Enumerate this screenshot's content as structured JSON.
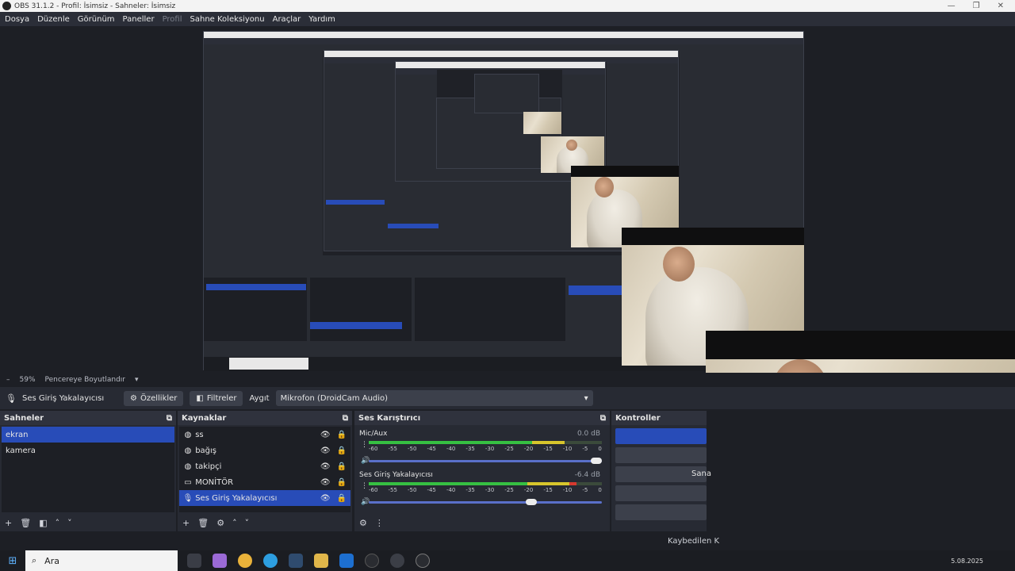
{
  "window": {
    "title": "OBS 31.1.2 - Profil: İsimsiz - Sahneler: İsimsiz"
  },
  "menu": {
    "items": [
      "Dosya",
      "Düzenle",
      "Görünüm",
      "Paneller",
      "Profil",
      "Sahne Koleksiyonu",
      "Araçlar",
      "Yardım"
    ]
  },
  "zoom": {
    "value": "59%",
    "mode": "Pencereye Boyutlandır"
  },
  "properties_bar": {
    "source_name": "Ses Giriş Yakalayıcısı",
    "properties_label": "Özellikler",
    "filters_label": "Filtreler",
    "device_label": "Aygıt",
    "device_value": "Mikrofon (DroidCam Audio)"
  },
  "scenes": {
    "title": "Sahneler",
    "items": [
      {
        "label": "ekran",
        "selected": true
      },
      {
        "label": "kamera",
        "selected": false
      }
    ]
  },
  "sources": {
    "title": "Kaynaklar",
    "items": [
      {
        "label": "ss",
        "icon": "globe-icon",
        "selected": false
      },
      {
        "label": "bağış",
        "icon": "globe-icon",
        "selected": false
      },
      {
        "label": "takipçi",
        "icon": "globe-icon",
        "selected": false
      },
      {
        "label": "MONİTÖR",
        "icon": "monitor-icon",
        "selected": false
      },
      {
        "label": "Ses Giriş Yakalayıcısı",
        "icon": "microphone-icon",
        "selected": true
      }
    ]
  },
  "mixer": {
    "title": "Ses Karıştırıcı",
    "ticks": [
      "-60",
      "-55",
      "-50",
      "-45",
      "-40",
      "-35",
      "-30",
      "-25",
      "-20",
      "-15",
      "-10",
      "-5",
      "0"
    ],
    "channels": [
      {
        "name": "Mic/Aux",
        "db": "0.0 dB",
        "level": 0.8,
        "volume": 1.0
      },
      {
        "name": "Ses Giriş Yakalayıcısı",
        "db": "-6.4 dB",
        "level": 0.85,
        "volume": 0.72
      }
    ]
  },
  "controls": {
    "title": "Kontroller",
    "partial_label": "Sana"
  },
  "status": {
    "dropped_frames": "Kaybedilen K"
  },
  "taskbar": {
    "search_placeholder": "Ara",
    "date": "5.08.2025"
  },
  "colors": {
    "accent": "#284cb8",
    "meter_green": "#36c042",
    "meter_yellow": "#d7c52c",
    "meter_red": "#d63a2f"
  }
}
